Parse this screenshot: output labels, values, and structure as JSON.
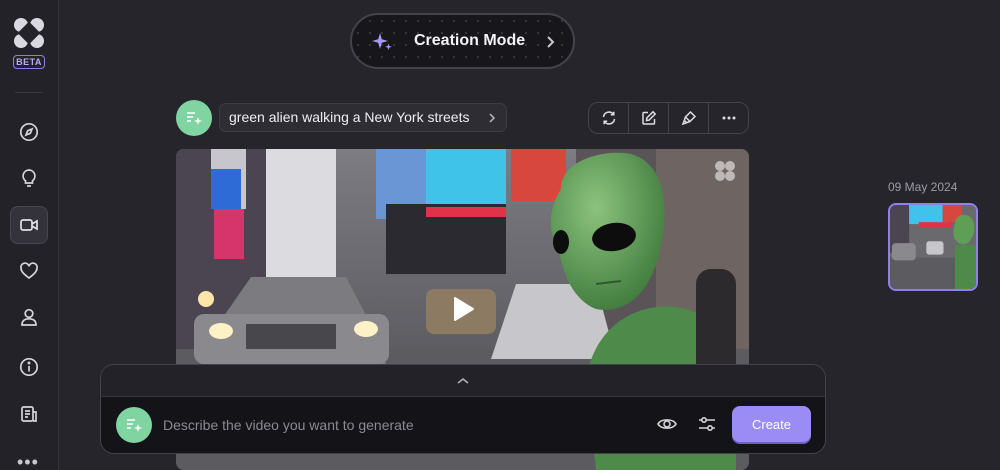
{
  "sidebar": {
    "badge": "BETA",
    "items": [
      {
        "icon": "compass-icon"
      },
      {
        "icon": "lightbulb-icon"
      },
      {
        "icon": "video-camera-icon",
        "active": true
      },
      {
        "icon": "heart-icon"
      },
      {
        "icon": "user-icon"
      },
      {
        "icon": "info-icon"
      },
      {
        "icon": "document-icon"
      }
    ],
    "more": "•••"
  },
  "mode": {
    "label": "Creation Mode",
    "icon": "sparkle-icon"
  },
  "prompt": {
    "text": "green alien walking a New York streets"
  },
  "toolbar": {
    "icons": [
      "refresh-icon",
      "edit-icon",
      "brush-icon",
      "more-icon"
    ]
  },
  "history": {
    "date": "09 May 2024"
  },
  "composer": {
    "placeholder": "Describe the video you want to generate",
    "value": "",
    "create_label": "Create"
  },
  "colors": {
    "accent": "#9b8cf5",
    "avatar": "#7fd4a2",
    "background": "#26252b"
  }
}
